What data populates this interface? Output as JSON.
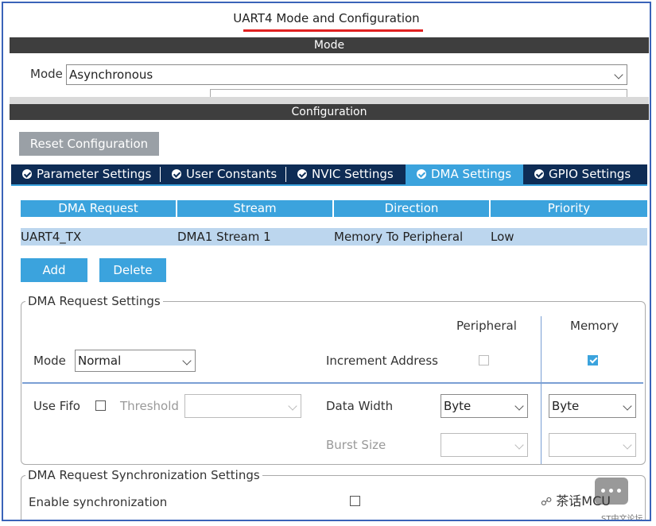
{
  "title": "UART4 Mode and Configuration",
  "mode_section": {
    "bar_label": "Mode",
    "mode_label": "Mode",
    "mode_value": "Asynchronous"
  },
  "config_section": {
    "bar_label": "Configuration",
    "reset_button": "Reset Configuration",
    "tabs": [
      {
        "label": "Parameter Settings",
        "active": false
      },
      {
        "label": "User Constants",
        "active": false
      },
      {
        "label": "NVIC Settings",
        "active": false
      },
      {
        "label": "DMA Settings",
        "active": true
      },
      {
        "label": "GPIO Settings",
        "active": false
      }
    ]
  },
  "dma_table": {
    "headers": [
      "DMA Request",
      "Stream",
      "Direction",
      "Priority"
    ],
    "rows": [
      [
        "UART4_TX",
        "DMA1 Stream 1",
        "Memory To Peripheral",
        "Low"
      ]
    ],
    "add_button": "Add",
    "delete_button": "Delete"
  },
  "request_settings": {
    "title": "DMA Request Settings",
    "peripheral_header": "Peripheral",
    "memory_header": "Memory",
    "mode_label": "Mode",
    "mode_value": "Normal",
    "increment_label": "Increment Address",
    "increment_peripheral": false,
    "increment_memory": true,
    "use_fifo_label": "Use Fifo",
    "threshold_label": "Threshold",
    "data_width_label": "Data Width",
    "data_width_peripheral": "Byte",
    "data_width_memory": "Byte",
    "burst_size_label": "Burst Size"
  },
  "sync_settings": {
    "title": "DMA Request Synchronization Settings",
    "enable_label": "Enable synchronization"
  },
  "watermark": {
    "main": "茶话MCU",
    "sub": "ST中文论坛"
  }
}
